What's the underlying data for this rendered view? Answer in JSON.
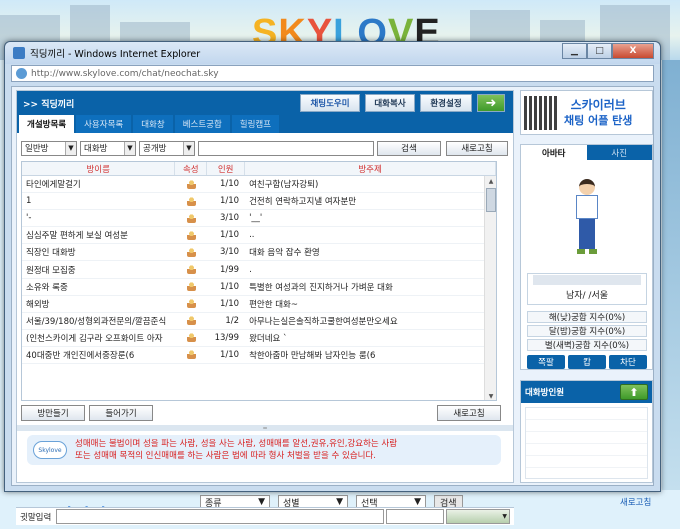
{
  "site": {
    "logo": [
      "S",
      "K",
      "Y",
      "L",
      "O",
      "V",
      "E"
    ],
    "bottom_brand": "스카이러브",
    "bottom_filters": [
      {
        "label": "종류",
        "width": 70
      },
      {
        "label": "성별",
        "width": 70
      },
      {
        "label": "선택",
        "width": 70
      }
    ],
    "bottom_search": "검색",
    "bottom_refresh": "새로고침"
  },
  "window": {
    "title": "직딩끼리 - Windows Internet Explorer",
    "address": "http://www.skylove.com/chat/neochat.sky",
    "buttons": {
      "minimize": "▁",
      "maximize": "□",
      "close": "X"
    }
  },
  "chat": {
    "header_title": ">> 직딩끼리",
    "header_buttons": {
      "help": "채팅도우미",
      "copy": "대화복사",
      "settings": "환경설정",
      "go": "➜"
    },
    "tabs": [
      "개설방목록",
      "사용자목록",
      "대화창",
      "베스트궁합",
      "힐링캠프"
    ],
    "active_tab": 0,
    "filters": {
      "room_type": "일반방",
      "chat_type": "대화방",
      "visibility": "공개방"
    },
    "search_label": "검색",
    "refresh_label": "새로고침",
    "columns": {
      "name": "방이름",
      "attr": "속성",
      "count": "인원",
      "topic": "방주제"
    },
    "rooms": [
      {
        "name": "타인에게말걸기",
        "count": "1/10",
        "topic": "여친구함(남자강퇴)"
      },
      {
        "name": "1",
        "count": "1/10",
        "topic": "건전히 연락하고지낼 여자분만"
      },
      {
        "name": "'-",
        "count": "3/10",
        "topic": "'__'"
      },
      {
        "name": "심심주말 편하게 보실 여성분",
        "count": "1/10",
        "topic": ".."
      },
      {
        "name": "직장인 대화방",
        "count": "3/10",
        "topic": "대화 음악 잡수 환영"
      },
      {
        "name": "원정대 모집중",
        "count": "1/99",
        "topic": "."
      },
      {
        "name": "소유와 록중",
        "count": "1/10",
        "topic": "특별한 여성과의 진지하거나 가벼운 대화"
      },
      {
        "name": "해외방",
        "count": "1/10",
        "topic": "편안한 대화~"
      },
      {
        "name": "서울/39/180/성형외과전문의/깔끔준식",
        "count": "1/2",
        "topic": "아무나는실은솔직하고쿨한여성분만오세요"
      },
      {
        "name": "(인천스카이게 김구라 오프화이트 아자",
        "count": "13/99",
        "topic": "왔더네요 `"
      },
      {
        "name": "40대중반 개인진에서중장룬(6",
        "count": "1/10",
        "topic": "착한아줌마 만남해봐 남자인능 룸(6"
      }
    ],
    "footer_buttons": {
      "enter": "방만들기",
      "join": "들어가기",
      "refresh": "새로고침"
    },
    "notice_logo": "Skylove",
    "notice_lines": [
      "성매매는 불법이며 성을 파는 사람, 성을 사는 사람, 성매매를 알선,권유,유인,강요하는 사람",
      "또는 성매매 목적의 인신매매를 하는 사람은 법에 따라 형사 처벌을 받을 수 있습니다."
    ],
    "input_label": "귓말입력"
  },
  "side": {
    "banner_line1": "스카이러브",
    "banner_line2": "채팅 어플 탄생",
    "avatar_tabs": [
      "아바타",
      "사진"
    ],
    "user_info": "남자/   /서울",
    "stats": [
      "해(낮)궁합 지수(0%)",
      "달(밤)궁합 지수(0%)",
      "별(새벽)궁합 지수(0%)"
    ],
    "actions": [
      "쪽팔",
      "캅",
      "차단"
    ],
    "participants_title": "대화방인원",
    "participants_up": "⬆"
  },
  "colors": {
    "accent": "#0a62a8",
    "warning": "#d82020",
    "brand": "#1c63c7"
  }
}
